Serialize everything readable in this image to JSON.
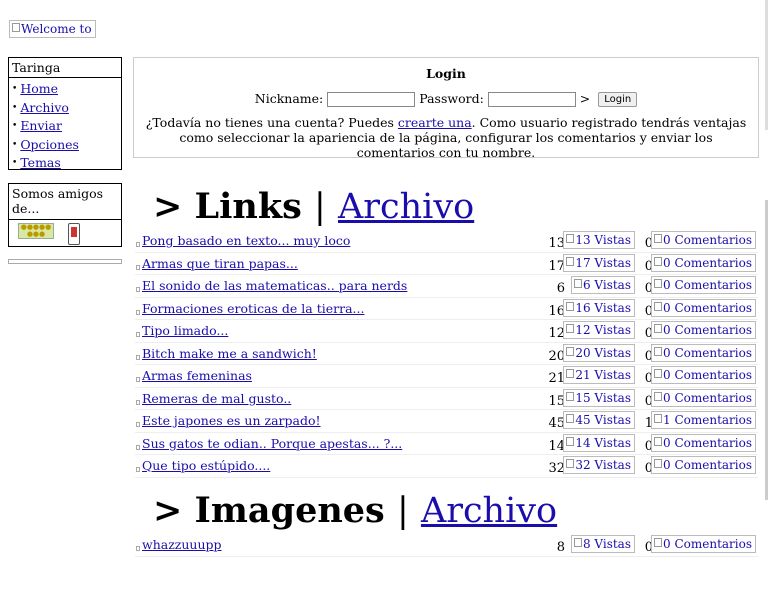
{
  "header": {
    "logo_alt": "Welcome to"
  },
  "sidebar": {
    "taringa": {
      "title": "Taringa",
      "items": [
        {
          "label": "Home"
        },
        {
          "label": "Archivo"
        },
        {
          "label": "Enviar"
        },
        {
          "label": "Opciones"
        },
        {
          "label": "Temas"
        }
      ]
    },
    "amigos": {
      "title": "Somos amigos de..."
    }
  },
  "login": {
    "title": "Login",
    "nickname_label": "Nickname:",
    "password_label": "Password:",
    "arrow": ">",
    "button_label": "Login",
    "info_before": "¿Todavía no tienes una cuenta? Puedes ",
    "info_link": "crearte una",
    "info_after": ". Como usuario registrado tendrás ventajas como seleccionar la apariencia de la página, configurar los comentarios y enviar los comentarios con tu nombre."
  },
  "links_section": {
    "prefix": "> Links",
    "separator": "|",
    "archive_link": "Archivo",
    "rows": [
      {
        "title": "Pong basado en texto... muy loco",
        "views": "13",
        "views_alt": "13 Vistas",
        "comments": "0",
        "comments_alt": "0 Comentarios"
      },
      {
        "title": "Armas que tiran papas...",
        "views": "17",
        "views_alt": "17 Vistas",
        "comments": "0",
        "comments_alt": "0 Comentarios"
      },
      {
        "title": "El sonido de las matematicas.. para nerds",
        "views": "6",
        "views_alt": "6 Vistas",
        "comments": "0",
        "comments_alt": "0 Comentarios"
      },
      {
        "title": "Formaciones eroticas de la tierra...",
        "views": "16",
        "views_alt": "16 Vistas",
        "comments": "0",
        "comments_alt": "0 Comentarios"
      },
      {
        "title": "Tipo limado...",
        "views": "12",
        "views_alt": "12 Vistas",
        "comments": "0",
        "comments_alt": "0 Comentarios"
      },
      {
        "title": "Bitch make me a sandwich!",
        "views": "20",
        "views_alt": "20 Vistas",
        "comments": "0",
        "comments_alt": "0 Comentarios"
      },
      {
        "title": "Armas femeninas",
        "views": "21",
        "views_alt": "21 Vistas",
        "comments": "0",
        "comments_alt": "0 Comentarios"
      },
      {
        "title": "Remeras de mal gusto..",
        "views": "15",
        "views_alt": "15 Vistas",
        "comments": "0",
        "comments_alt": "0 Comentarios"
      },
      {
        "title": "Este japones es un zarpado!",
        "views": "45",
        "views_alt": "45 Vistas",
        "comments": "1",
        "comments_alt": "1 Comentarios"
      },
      {
        "title": "Sus gatos te odian.. Porque apestas... ?...",
        "views": "14",
        "views_alt": "14 Vistas",
        "comments": "0",
        "comments_alt": "0 Comentarios"
      },
      {
        "title": "Que tipo estúpido....",
        "views": "32",
        "views_alt": "32 Vistas",
        "comments": "0",
        "comments_alt": "0 Comentarios"
      }
    ]
  },
  "imagenes_section": {
    "prefix": "> Imagenes",
    "separator": "|",
    "archive_link": "Archivo",
    "rows": [
      {
        "title": "whazzuuupp",
        "views": "8",
        "views_alt": "8 Vistas",
        "comments": "0",
        "comments_alt": "0 Comentarios"
      }
    ]
  }
}
